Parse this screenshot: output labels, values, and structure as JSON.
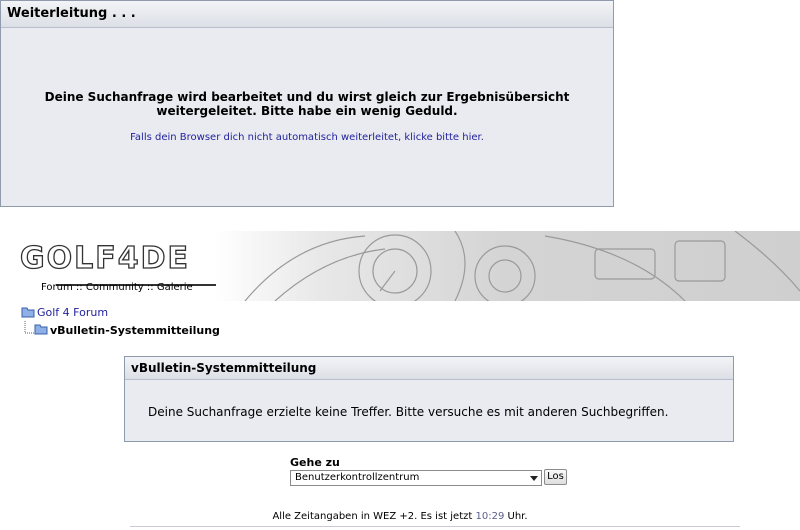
{
  "redirect": {
    "title": "Weiterleitung . . .",
    "message_line1": "Deine Suchanfrage wird bearbeitet und du wirst gleich zur Ergebnisübersicht",
    "message_line2": "weitergeleitet. Bitte habe ein wenig Geduld.",
    "fallback_link": "Falls dein Browser dich nicht automatisch weiterleitet, klicke bitte hier."
  },
  "header": {
    "logo_text": "GOLF4DE",
    "nav": {
      "forum": "Forum",
      "community": "Community",
      "galerie": "Galerie",
      "separator": "::"
    }
  },
  "breadcrumb": {
    "home": "Golf 4 Forum",
    "current": "vBulletin-Systemmitteilung"
  },
  "system_message": {
    "title": "vBulletin-Systemmitteilung",
    "body": "Deine Suchanfrage erzielte keine Treffer. Bitte versuche es mit anderen Suchbegriffen."
  },
  "goto": {
    "label": "Gehe zu",
    "selected": "Benutzerkontrollzentrum",
    "button": "Los"
  },
  "footer": {
    "prefix": "Alle Zeitangaben in WEZ +2. Es ist jetzt",
    "time": "10:29",
    "suffix": "Uhr."
  },
  "colors": {
    "link": "#22229c",
    "panel_bg": "#e9ebf0",
    "panel_border": "#8f9aad"
  }
}
